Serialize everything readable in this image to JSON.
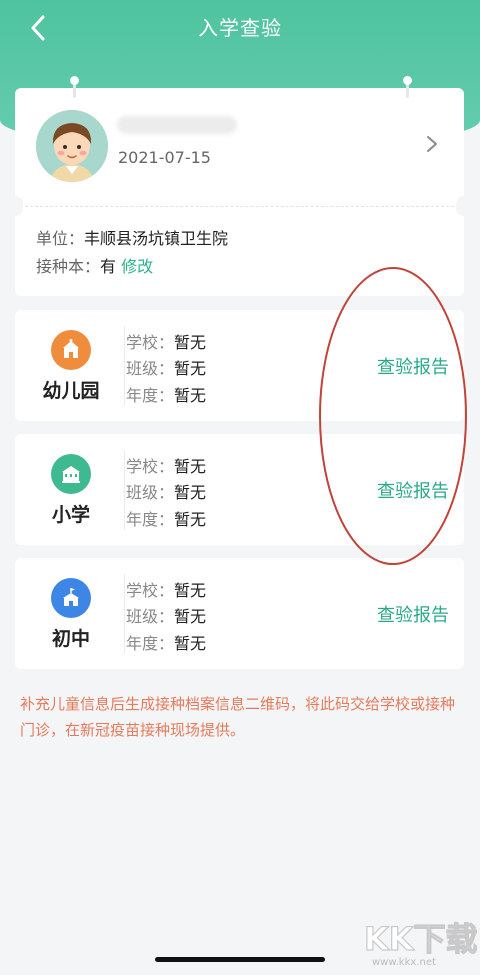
{
  "nav": {
    "title": "入学查验"
  },
  "profile": {
    "birthdate": "2021-07-15",
    "unit_label": "单位：",
    "unit_value": "丰顺县汤坑镇卫生院",
    "book_label": "接种本：",
    "book_value": "有",
    "book_action": "修改"
  },
  "schools": [
    {
      "type": "幼儿园",
      "icon": "kindergarten-icon",
      "color": "#ef8d3c",
      "school_label": "学校：",
      "school_value": "暂无",
      "class_label": "班级：",
      "class_value": "暂无",
      "year_label": "年度：",
      "year_value": "暂无",
      "report": "查验报告"
    },
    {
      "type": "小学",
      "icon": "primary-school-icon",
      "color": "#3fb98f",
      "school_label": "学校：",
      "school_value": "暂无",
      "class_label": "班级：",
      "class_value": "暂无",
      "year_label": "年度：",
      "year_value": "暂无",
      "report": "查验报告"
    },
    {
      "type": "初中",
      "icon": "middle-school-icon",
      "color": "#3e86e6",
      "school_label": "学校：",
      "school_value": "暂无",
      "class_label": "班级：",
      "class_value": "暂无",
      "year_label": "年度：",
      "year_value": "暂无",
      "report": "查验报告"
    }
  ],
  "notice": "补充儿童信息后生成接种档案信息二维码，将此码交给学校或接种门诊，在新冠疫苗接种现场提供。",
  "watermark": {
    "logo": "KK下载",
    "url": "www.kkx.net"
  },
  "colors": {
    "header": "#4ec39e",
    "link": "#2bb48d",
    "notice": "#e77a5a",
    "annotation": "#c0443a"
  }
}
